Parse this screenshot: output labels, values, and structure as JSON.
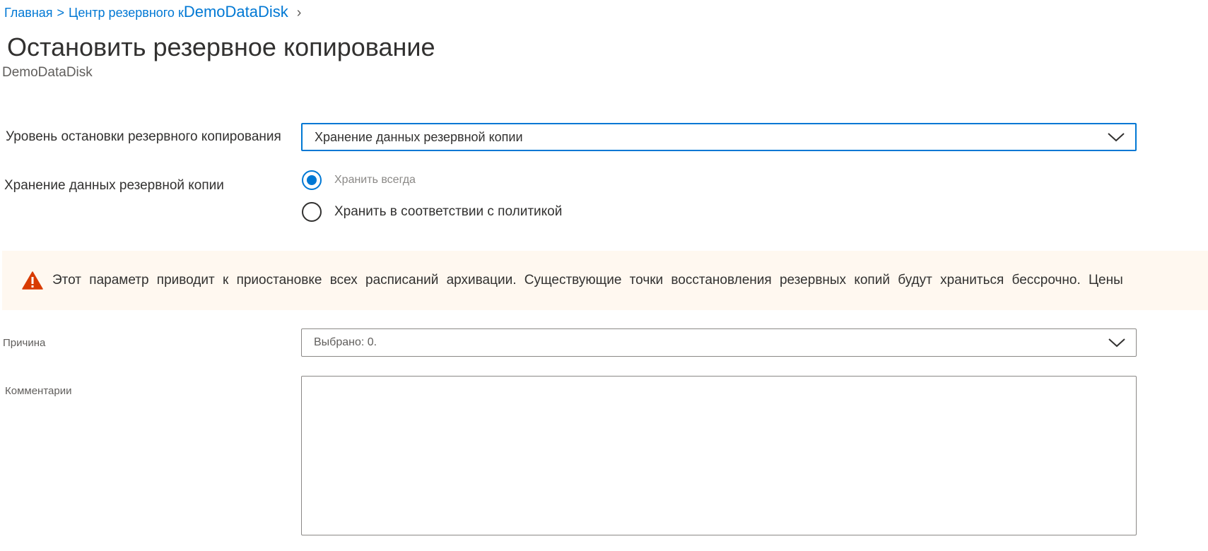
{
  "breadcrumb": {
    "home": "Главная",
    "separator": ">",
    "backup_center_partial": "Центр резервного к",
    "current": "DemoDataDisk",
    "chevron": "›"
  },
  "page": {
    "title": "Остановить резервное копирование",
    "subtitle": "DemoDataDisk"
  },
  "stop_level": {
    "label": "Уровень остановки резервного копирования",
    "selected": "Хранение данных резервной копии"
  },
  "retention": {
    "label": "Хранение данных резервной копии",
    "options": [
      {
        "label": "Хранить всегда",
        "checked": true
      },
      {
        "label": "Хранить в соответствии с политикой",
        "checked": false
      }
    ]
  },
  "warning": {
    "text": "Этот параметр приводит к приостановке всех расписаний архивации. Существующие точки восстановления резервных копий будут храниться бессрочно. Цены",
    "icon": "warning-icon",
    "icon_color": "#d83b01"
  },
  "reason": {
    "label": "Причина",
    "value": "Выбрано: 0."
  },
  "comments": {
    "label": "Комментарии",
    "value": ""
  },
  "colors": {
    "accent": "#0078d4",
    "warning_bg": "#fff8f0"
  }
}
